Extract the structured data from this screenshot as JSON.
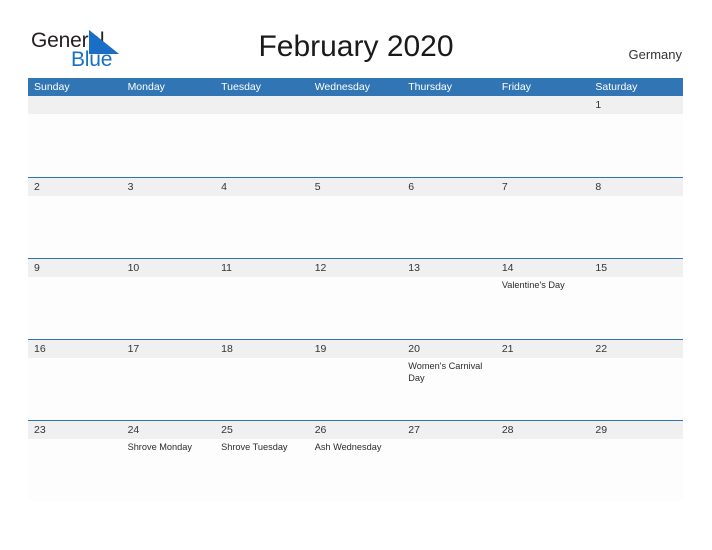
{
  "logo": {
    "word_one": "General",
    "word_two": "Blue",
    "flag_icon": "blue-flag-triangle-icon",
    "dark_color": "#231f20",
    "blue_color": "#1a6fc4"
  },
  "header": {
    "title": "February 2020",
    "country": "Germany"
  },
  "theme": {
    "header_blue": "#3175b4",
    "row_separator_blue": "#2e74b5",
    "number_strip_gray": "#f0f0f0",
    "cell_white": "#fdfdfd",
    "text_dark": "#333333"
  },
  "calendar": {
    "day_headers": [
      "Sunday",
      "Monday",
      "Tuesday",
      "Wednesday",
      "Thursday",
      "Friday",
      "Saturday"
    ],
    "weeks": [
      {
        "days": [
          {
            "num": "",
            "event": ""
          },
          {
            "num": "",
            "event": ""
          },
          {
            "num": "",
            "event": ""
          },
          {
            "num": "",
            "event": ""
          },
          {
            "num": "",
            "event": ""
          },
          {
            "num": "",
            "event": ""
          },
          {
            "num": "1",
            "event": ""
          }
        ]
      },
      {
        "days": [
          {
            "num": "2",
            "event": ""
          },
          {
            "num": "3",
            "event": ""
          },
          {
            "num": "4",
            "event": ""
          },
          {
            "num": "5",
            "event": ""
          },
          {
            "num": "6",
            "event": ""
          },
          {
            "num": "7",
            "event": ""
          },
          {
            "num": "8",
            "event": ""
          }
        ]
      },
      {
        "days": [
          {
            "num": "9",
            "event": ""
          },
          {
            "num": "10",
            "event": ""
          },
          {
            "num": "11",
            "event": ""
          },
          {
            "num": "12",
            "event": ""
          },
          {
            "num": "13",
            "event": ""
          },
          {
            "num": "14",
            "event": "Valentine's Day"
          },
          {
            "num": "15",
            "event": ""
          }
        ]
      },
      {
        "days": [
          {
            "num": "16",
            "event": ""
          },
          {
            "num": "17",
            "event": ""
          },
          {
            "num": "18",
            "event": ""
          },
          {
            "num": "19",
            "event": ""
          },
          {
            "num": "20",
            "event": "Women's Carnival Day"
          },
          {
            "num": "21",
            "event": ""
          },
          {
            "num": "22",
            "event": ""
          }
        ]
      },
      {
        "days": [
          {
            "num": "23",
            "event": ""
          },
          {
            "num": "24",
            "event": "Shrove Monday"
          },
          {
            "num": "25",
            "event": "Shrove Tuesday"
          },
          {
            "num": "26",
            "event": "Ash Wednesday"
          },
          {
            "num": "27",
            "event": ""
          },
          {
            "num": "28",
            "event": ""
          },
          {
            "num": "29",
            "event": ""
          }
        ]
      }
    ]
  }
}
